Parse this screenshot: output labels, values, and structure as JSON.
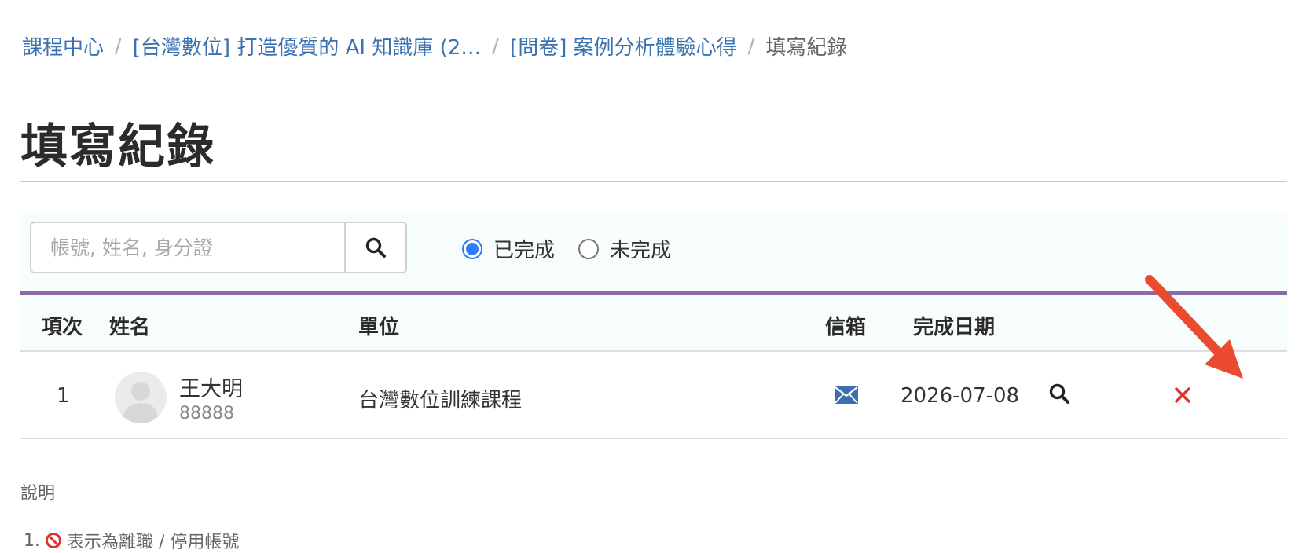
{
  "breadcrumb": {
    "items": [
      "課程中心",
      "[台灣數位] 打造優質的 AI 知識庫 (2…",
      "[問卷] 案例分析體驗心得"
    ],
    "current": "填寫紀錄",
    "separator": "/"
  },
  "page": {
    "title": "填寫紀錄"
  },
  "search": {
    "placeholder": "帳號, 姓名, 身分證",
    "value": "",
    "icon": "search-icon"
  },
  "status_filter": {
    "options": [
      {
        "label": "已完成",
        "checked": true
      },
      {
        "label": "未完成",
        "checked": false
      }
    ]
  },
  "table": {
    "columns": {
      "index": "項次",
      "name": "姓名",
      "unit": "單位",
      "email": "信箱",
      "completed_date": "完成日期"
    },
    "rows": [
      {
        "index": "1",
        "name": "王大明",
        "account": "88888",
        "unit": "台灣數位訓練課程",
        "email_icon": "envelope-icon",
        "completed_date": "2026-07-08",
        "view_icon": "search-icon",
        "delete_icon": "close-icon"
      }
    ]
  },
  "notes": {
    "title": "說明",
    "items": [
      {
        "number": "1.",
        "icon": "prohibited-icon",
        "text": "表示為離職 / 停用帳號"
      }
    ]
  },
  "colors": {
    "link": "#3a72b0",
    "accent_rule": "#8a6aa8",
    "radio_checked": "#2f7df6",
    "delete": "#e03131",
    "email_icon": "#3a6fb0",
    "annotation_arrow": "#ea4a2d",
    "prohibited": "#e03131"
  }
}
